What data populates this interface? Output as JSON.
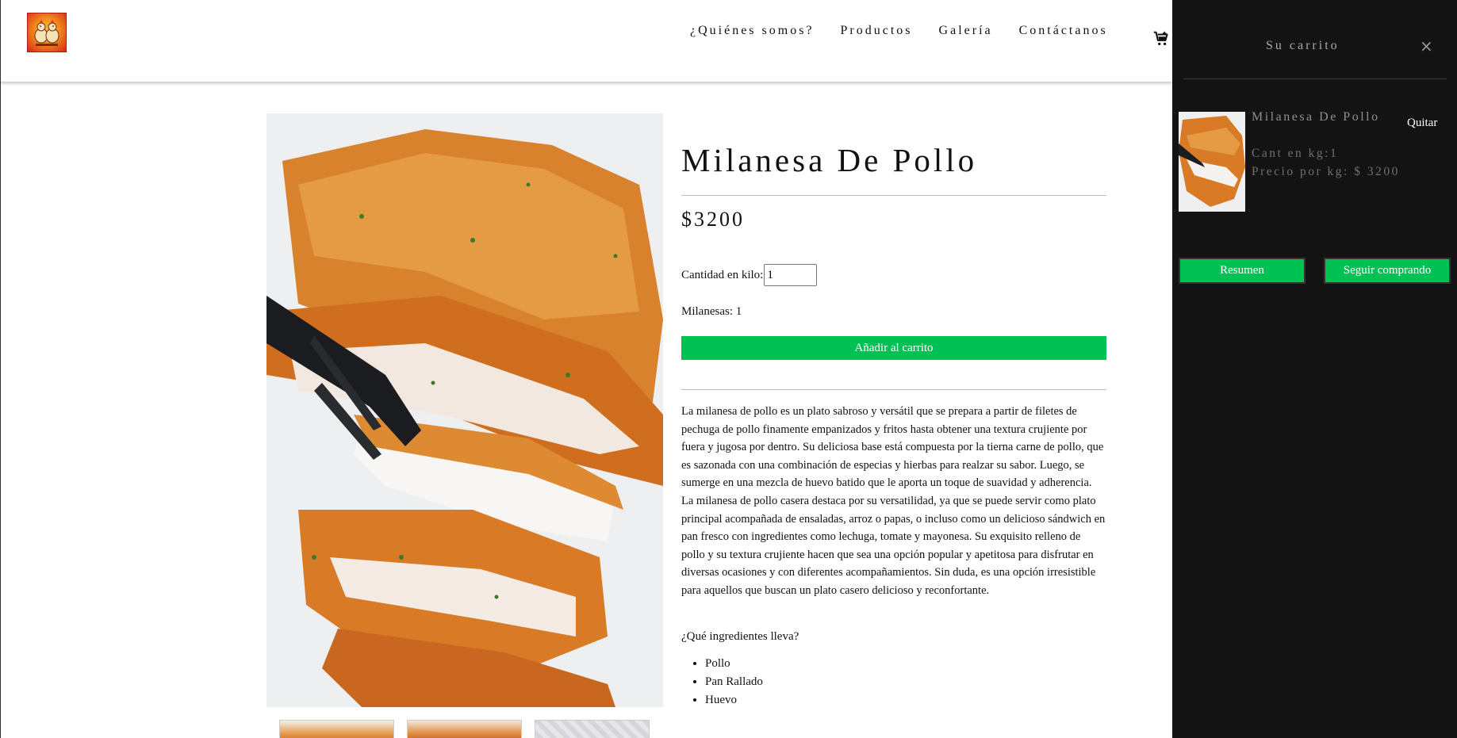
{
  "nav": {
    "items": [
      {
        "label": "¿Quiénes somos?"
      },
      {
        "label": "Productos"
      },
      {
        "label": "Galería"
      },
      {
        "label": "Contáctanos"
      }
    ]
  },
  "product": {
    "title": "Milanesa De Pollo",
    "price": "$3200",
    "qty_label": "Cantidad en kilo:",
    "qty_value": "1",
    "milanesas": "Milanesas: 1",
    "add_button": "Añadir al carrito",
    "description": "La milanesa de pollo es un plato sabroso y versátil que se prepara a partir de filetes de pechuga de pollo finamente empanizados y fritos hasta obtener una textura crujiente por fuera y jugosa por dentro. Su deliciosa base está compuesta por la tierna carne de pollo, que es sazonada con una combinación de especias y hierbas para realzar su sabor. Luego, se sumerge en una mezcla de huevo batido que le aporta un toque de suavidad y adherencia. La milanesa de pollo casera destaca por su versatilidad, ya que se puede servir como plato principal acompañada de ensaladas, arroz o papas, o incluso como un delicioso sándwich en pan fresco con ingredientes como lechuga, tomate y mayonesa. Su exquisito relleno de pollo y su textura crujiente hacen que sea una opción popular y apetitosa para disfrutar en diversas ocasiones y con diferentes acompañamientos. Sin duda, es una opción irresistible para aquellos que buscan un plato casero delicioso y reconfortante.",
    "ingredients_question": "¿Qué ingredientes lleva?",
    "ingredients": [
      "Pollo",
      "Pan Rallado",
      "Huevo"
    ]
  },
  "cart": {
    "title": "Su carrito",
    "close_icon": "×",
    "item": {
      "name": "Milanesa De Pollo",
      "remove": "Quitar",
      "qty": "Cant en kg:1",
      "price": "Precio por kg: $ 3200"
    },
    "summary_button": "Resumen",
    "continue_button": "Seguir comprando"
  },
  "colors": {
    "accent_green": "#00c153",
    "drawer_bg": "#131313"
  },
  "icons": {
    "cart": "shopping-cart-icon",
    "close": "close-icon",
    "logo": "chicken-logo"
  }
}
